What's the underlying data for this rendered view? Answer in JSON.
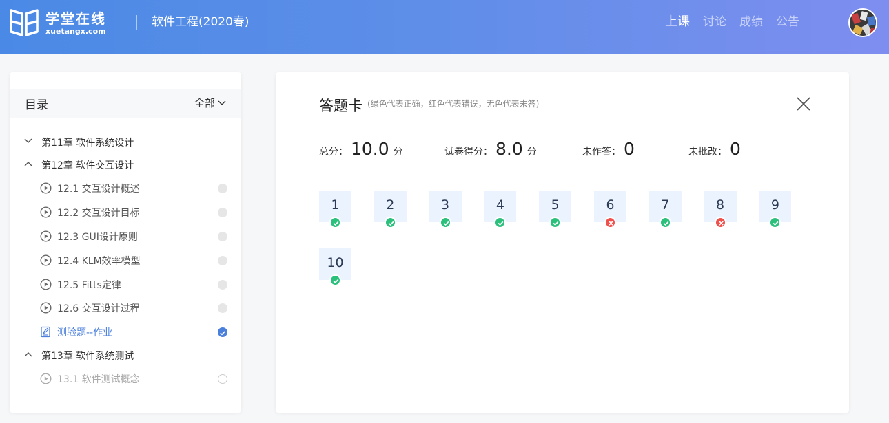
{
  "header": {
    "logo_cn": "学堂在线",
    "logo_en": "xuetangx.com",
    "course_title": "软件工程(2020春)",
    "nav": [
      {
        "label": "上课",
        "active": true
      },
      {
        "label": "讨论",
        "active": false
      },
      {
        "label": "成绩",
        "active": false
      },
      {
        "label": "公告",
        "active": false
      }
    ]
  },
  "sidebar": {
    "title": "目录",
    "filter": "全部",
    "chapters": [
      {
        "label": "第11章 软件系统设计",
        "expanded": false
      },
      {
        "label": "第12章 软件交互设计",
        "expanded": true
      },
      {
        "label": "第13章 软件系统测试",
        "expanded": true
      }
    ],
    "lessons": [
      {
        "label": "12.1 交互设计概述",
        "icon": "play-icon",
        "status": "none"
      },
      {
        "label": "12.2 交互设计目标",
        "icon": "play-icon",
        "status": "none"
      },
      {
        "label": "12.3 GUI设计原则",
        "icon": "play-icon",
        "status": "none"
      },
      {
        "label": "12.4 KLM效率模型",
        "icon": "play-icon",
        "status": "none"
      },
      {
        "label": "12.5 Fitts定律",
        "icon": "play-icon",
        "status": "none"
      },
      {
        "label": "12.6 交互设计过程",
        "icon": "play-icon",
        "status": "none"
      },
      {
        "label": "测验题--作业",
        "icon": "quiz-icon",
        "status": "done"
      },
      {
        "label": "13.1 软件测试概念",
        "icon": "play-icon",
        "status": "empty"
      }
    ]
  },
  "answer_card": {
    "title": "答题卡",
    "note": "(绿色代表正确，红色代表错误，无色代表未答)",
    "stats": [
      {
        "label": "总分：",
        "value": "10.0",
        "unit": "分"
      },
      {
        "label": "试卷得分：",
        "value": "8.0",
        "unit": "分"
      },
      {
        "label": "未作答：",
        "value": "0",
        "unit": ""
      },
      {
        "label": "未批改：",
        "value": "0",
        "unit": ""
      }
    ],
    "questions": [
      {
        "n": "1",
        "correct": true
      },
      {
        "n": "2",
        "correct": true
      },
      {
        "n": "3",
        "correct": true
      },
      {
        "n": "4",
        "correct": true
      },
      {
        "n": "5",
        "correct": true
      },
      {
        "n": "6",
        "correct": false
      },
      {
        "n": "7",
        "correct": true
      },
      {
        "n": "8",
        "correct": false
      },
      {
        "n": "9",
        "correct": true
      },
      {
        "n": "10",
        "correct": true
      }
    ]
  },
  "colors": {
    "correct": "#2bc07c",
    "wrong": "#f0514d",
    "accent": "#4a7fdc"
  }
}
